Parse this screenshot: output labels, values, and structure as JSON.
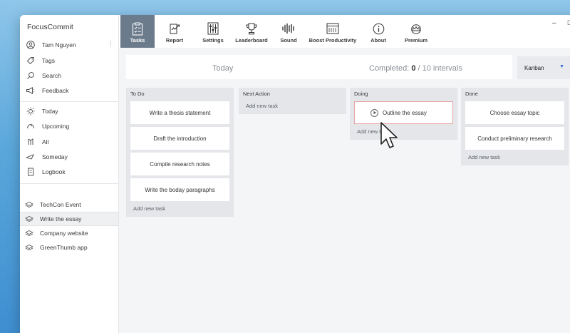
{
  "app_title": "FocusCommit",
  "user": {
    "name": "Tam Nguyen",
    "menu_icon": "kebab-menu-icon"
  },
  "sidebar_items": [
    {
      "label": "Tags",
      "icon": "tag-icon"
    },
    {
      "label": "Search",
      "icon": "search-icon"
    },
    {
      "label": "Feedback",
      "icon": "megaphone-icon"
    },
    {
      "label": "Today",
      "icon": "sun-icon"
    },
    {
      "label": "Upcoming",
      "icon": "upcoming-icon"
    },
    {
      "label": "All",
      "icon": "all-icon"
    },
    {
      "label": "Someday",
      "icon": "someday-icon"
    },
    {
      "label": "Logbook",
      "icon": "logbook-icon"
    }
  ],
  "projects": [
    {
      "label": "TechCon Event"
    },
    {
      "label": "Write the essay",
      "active": true
    },
    {
      "label": "Company website"
    },
    {
      "label": "GreenThumb app"
    }
  ],
  "toolbar": [
    {
      "label": "Tasks",
      "icon": "clipboard-icon",
      "active": true
    },
    {
      "label": "Report",
      "icon": "report-icon"
    },
    {
      "label": "Settings",
      "icon": "settings-icon"
    },
    {
      "label": "Leaderboard",
      "icon": "trophy-icon"
    },
    {
      "label": "Sound",
      "icon": "sound-wave-icon"
    },
    {
      "label": "Boost Productivity",
      "icon": "browser-icon"
    },
    {
      "label": "About",
      "icon": "info-icon"
    },
    {
      "label": "Premium",
      "icon": "crown-icon"
    }
  ],
  "status": {
    "today_label": "Today",
    "completed_prefix": "Completed: ",
    "completed_count": "0",
    "completed_suffix": " / 10 intervals",
    "view_select": "Kanban"
  },
  "columns": [
    {
      "title": "To Do",
      "cards": [
        "Write a thesis statement",
        "Draft the introduction",
        "Compile research notes",
        "Write the boday paragraphs"
      ],
      "add": "Add new task"
    },
    {
      "title": "Next Action",
      "cards": [],
      "add": "Add new task"
    },
    {
      "title": "Doing",
      "cards": [
        "Outline the essay"
      ],
      "add": "Add new task"
    },
    {
      "title": "Done",
      "cards": [
        "Choose essay topic",
        "Conduct preliminary research"
      ],
      "add": "Add new task"
    }
  ],
  "colors": {
    "active_tab": "#6b7b8c",
    "highlight_border": "#e7a4a4",
    "accent": "#2f6bd8"
  }
}
